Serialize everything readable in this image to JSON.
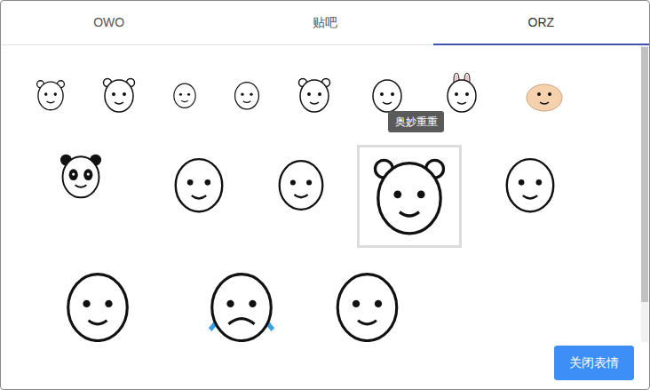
{
  "tabs": [
    {
      "label": "OWO",
      "selected": false
    },
    {
      "label": "贴吧",
      "selected": false
    },
    {
      "label": "ORZ",
      "selected": true
    }
  ],
  "sticker_rows": [
    [
      {
        "kind": "bear",
        "hovered": false
      },
      {
        "kind": "bear-sweat",
        "hovered": false
      },
      {
        "kind": "face",
        "hovered": false
      },
      {
        "kind": "face",
        "hovered": false
      },
      {
        "kind": "bear",
        "hovered": false
      },
      {
        "kind": "face",
        "hovered": false
      },
      {
        "kind": "bunny",
        "hovered": false
      },
      {
        "kind": "blob",
        "hovered": false
      }
    ],
    [
      {
        "kind": "panda",
        "hovered": false
      },
      {
        "kind": "face",
        "hovered": false
      },
      {
        "kind": "face",
        "hovered": false
      },
      {
        "kind": "bear",
        "hovered": true
      },
      {
        "kind": "face",
        "hovered": false
      }
    ],
    [
      {
        "kind": "face",
        "hovered": false
      },
      {
        "kind": "crying",
        "hovered": false
      },
      {
        "kind": "face",
        "hovered": false
      }
    ]
  ],
  "tooltip": {
    "text": "奥妙重重"
  },
  "scrollbar": {
    "level": 0.86
  },
  "buttons": [
    "关闭表情"
  ]
}
